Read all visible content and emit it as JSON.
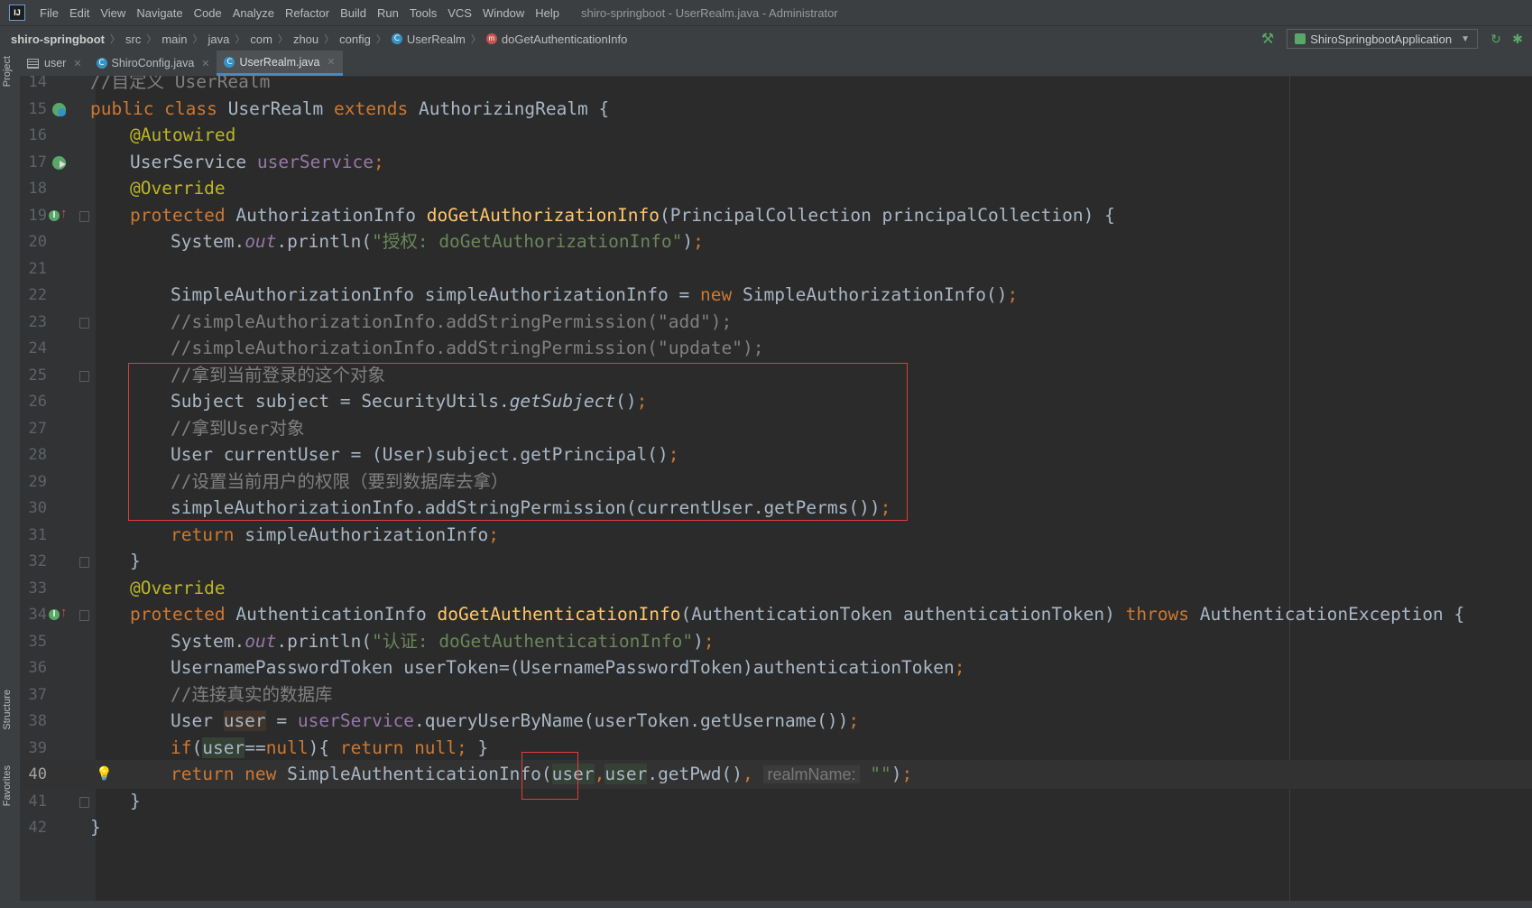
{
  "menubar": {
    "logo": "IJ",
    "items": [
      "File",
      "Edit",
      "View",
      "Navigate",
      "Code",
      "Analyze",
      "Refactor",
      "Build",
      "Run",
      "Tools",
      "VCS",
      "Window",
      "Help"
    ],
    "title": "shiro-springboot - UserRealm.java - Administrator"
  },
  "breadcrumb": {
    "root": "shiro-springboot",
    "parts": [
      "src",
      "main",
      "java",
      "com",
      "zhou",
      "config"
    ],
    "class": "UserRealm",
    "method": "doGetAuthenticationInfo"
  },
  "toolbar": {
    "run_config": "ShiroSpringbootApplication"
  },
  "tabs": [
    {
      "label": "user",
      "icon": "table-icon"
    },
    {
      "label": "ShiroConfig.java",
      "icon": "class-icon"
    },
    {
      "label": "UserRealm.java",
      "icon": "class-icon"
    }
  ],
  "sidebar": {
    "top": "Project",
    "structure": "Structure",
    "favorites": "Favorites"
  },
  "editor": {
    "current_line": 40,
    "line_numbers": [
      "14",
      "15",
      "16",
      "17",
      "18",
      "19",
      "20",
      "21",
      "22",
      "23",
      "24",
      "25",
      "26",
      "27",
      "28",
      "29",
      "30",
      "31",
      "32",
      "33",
      "34",
      "35",
      "36",
      "37",
      "38",
      "39",
      "40",
      "41",
      "42"
    ],
    "l14": {
      "c1": "//自定义 UserRealm"
    },
    "l15": {
      "k1": "public class ",
      "t1": "UserRealm ",
      "k2": "extends ",
      "t2": "AuthorizingRealm {"
    },
    "l16": {
      "a1": "@Autowired"
    },
    "l17": {
      "t1": "UserService ",
      "f1": "userService",
      "k1": ";"
    },
    "l18": {
      "a1": "@Override"
    },
    "l19": {
      "k1": "protected ",
      "t1": "AuthorizationInfo ",
      "m1": "doGetAuthorizationInfo",
      "t2": "(PrincipalCollection principalCollection) {"
    },
    "l20": {
      "t1": "System.",
      "f1": "out",
      "t2": ".println(",
      "s1": "\"授权: doGetAuthorizationInfo\"",
      "t3": ")",
      "k1": ";"
    },
    "l22": {
      "t1": "SimpleAuthorizationInfo simpleAuthorizationInfo = ",
      "k1": "new ",
      "t2": "SimpleAuthorizationInfo()",
      "k2": ";"
    },
    "l23": {
      "c1": "//simpleAuthorizationInfo.addStringPermission(\"add\");"
    },
    "l24": {
      "c1": "//simpleAuthorizationInfo.addStringPermission(\"update\");"
    },
    "l25": {
      "c1": "//拿到当前登录的这个对象"
    },
    "l26": {
      "t1": "Subject subject = SecurityUtils.",
      "i1": "getSubject",
      "t2": "()",
      "k1": ";"
    },
    "l27": {
      "c1": "//拿到User对象"
    },
    "l28": {
      "t1": "User currentUser = (User)subject.getPrincipal()",
      "k1": ";"
    },
    "l29": {
      "c1": "//设置当前用户的权限（要到数据库去拿）"
    },
    "l30": {
      "t1": "simpleAuthorizationInfo.addStringPermission(currentUser.getPerms())",
      "k1": ";"
    },
    "l31": {
      "k1": "return ",
      "t1": "simpleAuthorizationInfo",
      "k2": ";"
    },
    "l32": {
      "t1": "}"
    },
    "l33": {
      "a1": "@Override"
    },
    "l34": {
      "k1": "protected ",
      "t1": "AuthenticationInfo ",
      "m1": "doGetAuthenticationInfo",
      "t2": "(AuthenticationToken authenticationToken) ",
      "k2": "throws ",
      "t3": "AuthenticationException {"
    },
    "l35": {
      "t1": "System.",
      "f1": "out",
      "t2": ".println(",
      "s1": "\"认证: doGetAuthenticationInfo\"",
      "t3": ")",
      "k1": ";"
    },
    "l36": {
      "t1": "UsernamePasswordToken userToken=(UsernamePasswordToken)authenticationToken",
      "k1": ";"
    },
    "l37": {
      "c1": "//连接真实的数据库"
    },
    "l38": {
      "t1": "User ",
      "v1": "user",
      "t2": " = ",
      "f1": "userService",
      "t3": ".queryUserByName(userToken.getUsername())",
      "k1": ";"
    },
    "l39": {
      "k1": "if",
      "t1": "(",
      "v1": "user",
      "t2": "==",
      "k2": "null",
      "t3": "){ ",
      "k3": "return null; ",
      "t4": "}"
    },
    "l40": {
      "k1": "return new ",
      "t1": "SimpleAuthenticationInfo(",
      "v1": "user",
      "k2": ",",
      "v2": "user",
      "t2": ".getPwd()",
      "k3": ", ",
      "h1": "realmName:",
      "s1": " \"\"",
      "t3": ")",
      "k4": ";"
    },
    "l41": {
      "t1": "}"
    },
    "l42": {
      "t1": "}"
    }
  },
  "colors": {
    "keyword": "#cc7832",
    "annotation": "#bbb529",
    "field": "#9876aa",
    "method": "#ffc66d",
    "string": "#6a8759",
    "comment": "#808080",
    "plain": "#a9b7c6",
    "highlight_box": "#e03c3c"
  }
}
